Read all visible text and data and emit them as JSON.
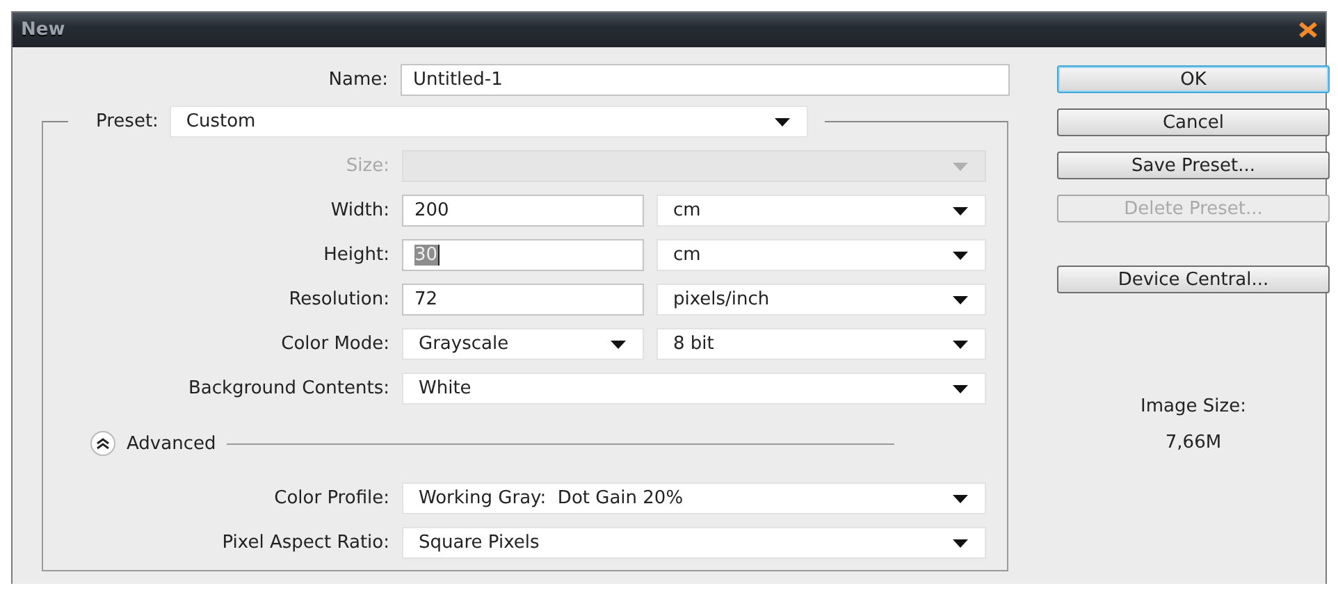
{
  "window": {
    "title": "New"
  },
  "name": {
    "label": "Name:",
    "value": "Untitled-1"
  },
  "preset": {
    "label": "Preset:",
    "value": "Custom"
  },
  "rows": [
    {
      "kind": "select",
      "label": "Size:",
      "disabled": true
    },
    {
      "kind": "input_unit",
      "label": "Width:",
      "value": "200",
      "unit": "cm",
      "disabled": false,
      "text_selected": false
    },
    {
      "kind": "input_unit",
      "label": "Height:",
      "value": "30",
      "unit": "cm",
      "disabled": false,
      "text_selected": true
    },
    {
      "kind": "input_unit",
      "label": "Resolution:",
      "value": "72",
      "unit": "pixels/inch",
      "disabled": false,
      "text_selected": false
    },
    {
      "kind": "select_pair",
      "label": "Color Mode:",
      "value": "Grayscale",
      "unit": "8 bit",
      "disabled": false
    },
    {
      "kind": "select",
      "label": "Background Contents:",
      "value": "White",
      "disabled": false
    }
  ],
  "advanced": {
    "label": "Advanced",
    "expanded": true,
    "rows": [
      {
        "kind": "select",
        "label": "Color Profile:",
        "value": "Working Gray:  Dot Gain 20%",
        "disabled": false
      },
      {
        "kind": "select",
        "label": "Pixel Aspect Ratio:",
        "value": "Square Pixels",
        "disabled": false
      }
    ]
  },
  "buttons": [
    {
      "label": "OK",
      "default": true,
      "disabled": false
    },
    {
      "label": "Cancel",
      "default": false,
      "disabled": false
    },
    {
      "label": "Save Preset...",
      "default": false,
      "disabled": false
    },
    {
      "label": "Delete Preset...",
      "default": false,
      "disabled": true
    },
    {
      "label": "Device Central...",
      "default": false,
      "disabled": false
    }
  ],
  "image_size": {
    "label": "Image Size:",
    "value": "7,66M"
  }
}
